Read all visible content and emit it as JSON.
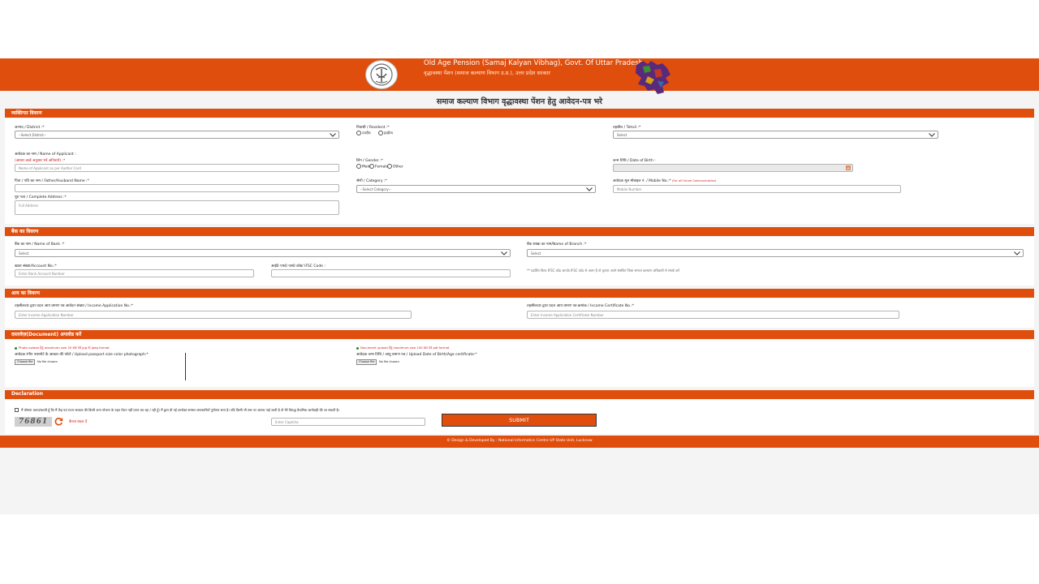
{
  "header": {
    "title_en": "Old Age Pension (Samaj Kalyan Vibhag), Govt. Of Uttar Pradesh",
    "title_hi": "वृद्धावस्था पेंशन (समाज कल्याण विभाग उ.प्र.), उत्तर प्रदेश सरकार"
  },
  "page_title": "समाज कल्याण विभाग वृद्धावस्था पेंशन हेतु आवेदन-पत्र भरे",
  "personal": {
    "section_title": "व्यक्तिगत विवरण",
    "district_label": "जनपद / District :*",
    "district_value": "--Select District--",
    "resident_label": "निवासी / Resident :*",
    "resident_options": [
      "नगरीय",
      "ग्रामीण"
    ],
    "tehsil_label": "तहसील / Tehsil :*",
    "tehsil_value": "Select",
    "applicant_label": "आवेदक का नाम / Name of Applicant :",
    "applicant_note": "(आधार कार्ड अनुसार भरे अनिवार्य) :*",
    "applicant_placeholder": "Name of Applicant as per Aadhar Card",
    "gender_label": "लिंग / Gender :*",
    "gender_options": [
      "Male",
      "Female",
      "Other"
    ],
    "dob_label": "जन्म तिथि / Date of Birth :",
    "father_label": "पिता / पति का नाम / Father/Husband Name :*",
    "category_label": "श्रेणी / Category :*",
    "category_value": "--Select Category--",
    "mobile_label": "आवेदक मूल मोबाइल नं. / Mobile No.:*",
    "mobile_note": "(For all Future Communication)",
    "mobile_placeholder": "Mobile Number",
    "address_label": "पूरा पता / Complete Address :*",
    "address_placeholder": "Full Address"
  },
  "bank": {
    "section_title": "बैंक का विवरण",
    "bank_label": "बैंक का नाम / Name of Bank :*",
    "bank_value": "Select",
    "branch_label": "बैंक शाखा का नाम/Name of Branch :*",
    "branch_value": "Select",
    "account_label": "खाता संख्या/Account No.:*",
    "account_placeholder": "Enter Bank Account Number",
    "ifsc_label": "आई0 एफ0 एस0 कोड/ IFSC Code :",
    "ifsc_note": "** प्रदर्शित किया IFSC कोड आपके IFSC कोड से अलग है तो कृपया अपने संबंधित जिला समाज कल्याण अधिकारी से संपर्क करें"
  },
  "income": {
    "section_title": "आय का विवरण",
    "app_label": "तहसीलदार द्वारा प्रदत्त आय प्रमाण पत्र आवेदन संख्या / Income Application No.:*",
    "app_placeholder": "Enter Income Application Number",
    "cert_label": "तहसीलदार द्वारा प्रदत्त आय प्रमाण पत्र क्रमांक / Income Certificate No.:*",
    "cert_placeholder": "Enter Income Application Certificate Number"
  },
  "documents": {
    "section_title": "दस्तावेज़(Document) अपलोड करें",
    "photo_note": "Photo upload हेतु maximum size 20 KB एवं jpg या jpeg format",
    "photo_label": "आवेदक रंगीन पासपोर्ट के आकार की फोटो / Upload passport size color photograph:*",
    "dob_note": "Document upload हेतु maximum size 100 KB एवं pdf format",
    "dob_label": "आवेदक जन्म तिथि / आयु प्रमाण पत्र / Upload Date of Birth/Age certificate:*",
    "choose_file": "Choose file",
    "no_file": "No file chosen"
  },
  "declaration": {
    "section_title": "Declaration",
    "text": "मैं घोषणा करता/करती हूँ कि मैं केंद्र एवं राज्य सरकार की किसी अन्य योजना के तहत पेंशन नहीं प्राप्त कर रहा / रही हूँ। मैं द्वारा दी गई उपरोक्त समस्त जानकारियाँ पूर्णतया सत्य है। यदि किसी भी स्तर पर असत्य पाई जाती है तो मेरे विरुद्ध वैधानिक कार्यवाही की जा सकती है।",
    "captcha_value": "76861",
    "refresh_text": "कैप्चा बदल दें",
    "captcha_placeholder": "Enter Captcha",
    "submit_label": "SUBMIT"
  },
  "footer": {
    "text": "© Design & Developed By : National Informatics Centre UP State Unit, Lucknow"
  },
  "colors": {
    "brand": "#e04e0d",
    "accent_red": "#d01818",
    "note_green": "#1d8a2c"
  }
}
